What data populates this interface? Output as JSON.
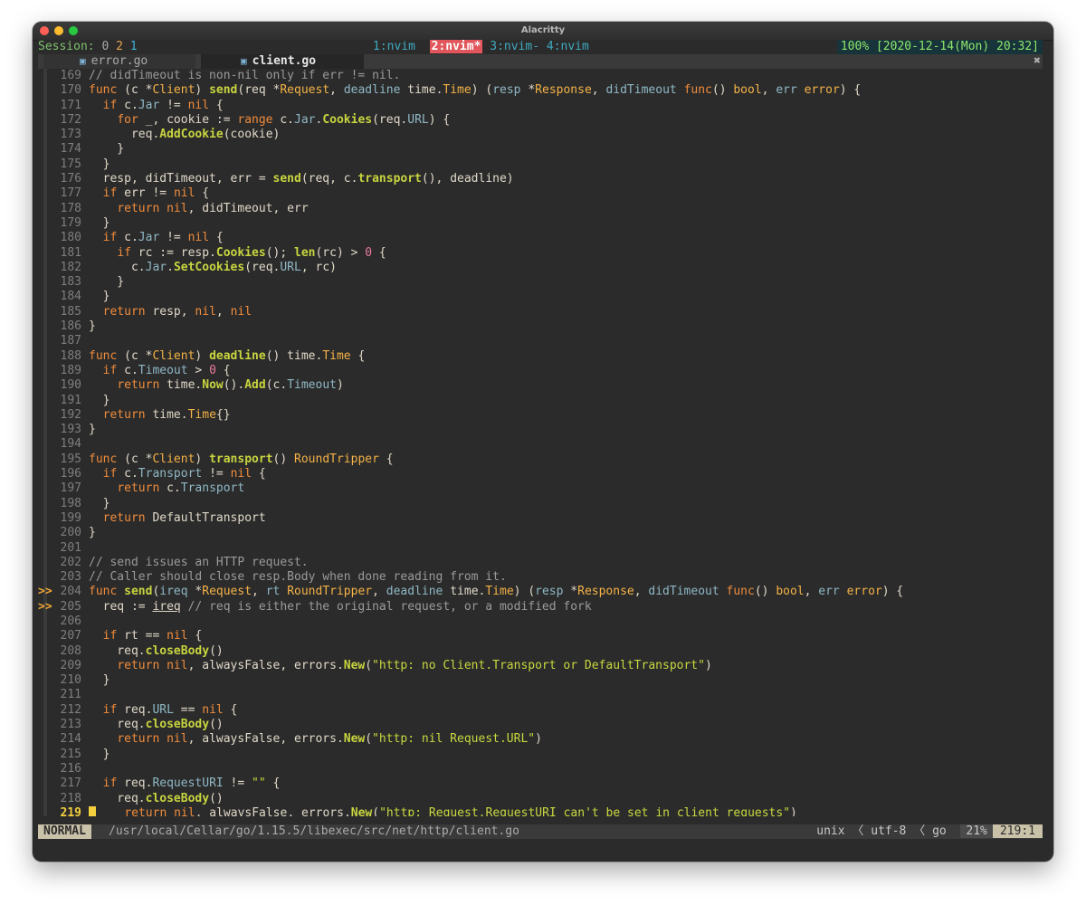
{
  "window": {
    "title": "Alacritty"
  },
  "tmux": {
    "session_label": "Session:",
    "session_nums": [
      "0",
      "2",
      "1"
    ],
    "windows": [
      "1:nvim",
      "2:nvim*",
      "3:nvim-",
      "4:nvim"
    ],
    "active_window": 1,
    "status": "100% [2020-12-14(Mon) 20:32]"
  },
  "tabs": [
    {
      "name": "error.go",
      "active": false
    },
    {
      "name": "client.go",
      "active": true
    }
  ],
  "tab_close_glyph": "✖",
  "statusline": {
    "mode": "NORMAL",
    "path": "/usr/local/Cellar/go/1.15.5/libexec/src/net/http/client.go",
    "format": "unix",
    "encoding": "utf-8",
    "filetype": "go",
    "percent": "21%",
    "position": "219:1"
  },
  "code_lines": [
    {
      "n": "",
      "sign": "",
      "tokens": [
        [
          "c",
          "// didTimeout is non-nil only if err != nil."
        ]
      ]
    },
    {
      "n": "169",
      "sign": "",
      "tokens": [
        [
          "c",
          "// didTimeout is non-nil only if err != nil."
        ]
      ]
    },
    {
      "n": "170",
      "sign": "",
      "tokens": [
        [
          "k",
          "func"
        ],
        [
          "op",
          " ("
        ],
        [
          "op",
          "c "
        ],
        [
          "op",
          "*"
        ],
        [
          "ty",
          "Client"
        ],
        [
          "op",
          ") "
        ],
        [
          "fn",
          "send"
        ],
        [
          "op",
          "(req "
        ],
        [
          "op",
          "*"
        ],
        [
          "ty",
          "Request"
        ],
        [
          "op",
          ", "
        ],
        [
          "f",
          "deadline"
        ],
        [
          "op",
          " time."
        ],
        [
          "ty",
          "Time"
        ],
        [
          "op",
          ") ("
        ],
        [
          "f",
          "resp"
        ],
        [
          "op",
          " *"
        ],
        [
          "ty",
          "Response"
        ],
        [
          "op",
          ", "
        ],
        [
          "f",
          "didTimeout"
        ],
        [
          "op",
          " "
        ],
        [
          "k",
          "func"
        ],
        [
          "op",
          "() "
        ],
        [
          "ty",
          "bool"
        ],
        [
          "op",
          ", "
        ],
        [
          "f",
          "err"
        ],
        [
          "op",
          " "
        ],
        [
          "ty",
          "error"
        ],
        [
          "op",
          ") {"
        ]
      ]
    },
    {
      "n": "171",
      "sign": "",
      "tokens": [
        [
          "op",
          "  "
        ],
        [
          "k",
          "if"
        ],
        [
          "op",
          " c."
        ],
        [
          "f",
          "Jar"
        ],
        [
          "op",
          " != "
        ],
        [
          "k",
          "nil"
        ],
        [
          "op",
          " {"
        ]
      ]
    },
    {
      "n": "172",
      "sign": "",
      "tokens": [
        [
          "op",
          "    "
        ],
        [
          "k",
          "for"
        ],
        [
          "op",
          " _, cookie := "
        ],
        [
          "k",
          "range"
        ],
        [
          "op",
          " c."
        ],
        [
          "f",
          "Jar"
        ],
        [
          "op",
          "."
        ],
        [
          "fn",
          "Cookies"
        ],
        [
          "op",
          "(req."
        ],
        [
          "f",
          "URL"
        ],
        [
          "op",
          ") {"
        ]
      ]
    },
    {
      "n": "173",
      "sign": "",
      "tokens": [
        [
          "op",
          "      req."
        ],
        [
          "fn",
          "AddCookie"
        ],
        [
          "op",
          "(cookie)"
        ]
      ]
    },
    {
      "n": "174",
      "sign": "",
      "tokens": [
        [
          "op",
          "    }"
        ]
      ]
    },
    {
      "n": "175",
      "sign": "",
      "tokens": [
        [
          "op",
          "  }"
        ]
      ]
    },
    {
      "n": "176",
      "sign": "",
      "tokens": [
        [
          "op",
          "  resp, didTimeout, err = "
        ],
        [
          "fn",
          "send"
        ],
        [
          "op",
          "(req, c."
        ],
        [
          "fn",
          "transport"
        ],
        [
          "op",
          "(), deadline)"
        ]
      ]
    },
    {
      "n": "177",
      "sign": "",
      "tokens": [
        [
          "op",
          "  "
        ],
        [
          "k",
          "if"
        ],
        [
          "op",
          " err != "
        ],
        [
          "k",
          "nil"
        ],
        [
          "op",
          " {"
        ]
      ]
    },
    {
      "n": "178",
      "sign": "",
      "tokens": [
        [
          "op",
          "    "
        ],
        [
          "k",
          "return"
        ],
        [
          "op",
          " "
        ],
        [
          "k",
          "nil"
        ],
        [
          "op",
          ", didTimeout, err"
        ]
      ]
    },
    {
      "n": "179",
      "sign": "",
      "tokens": [
        [
          "op",
          "  }"
        ]
      ]
    },
    {
      "n": "180",
      "sign": "",
      "tokens": [
        [
          "op",
          "  "
        ],
        [
          "k",
          "if"
        ],
        [
          "op",
          " c."
        ],
        [
          "f",
          "Jar"
        ],
        [
          "op",
          " != "
        ],
        [
          "k",
          "nil"
        ],
        [
          "op",
          " {"
        ]
      ]
    },
    {
      "n": "181",
      "sign": "",
      "tokens": [
        [
          "op",
          "    "
        ],
        [
          "k",
          "if"
        ],
        [
          "op",
          " rc := resp."
        ],
        [
          "fn",
          "Cookies"
        ],
        [
          "op",
          "(); "
        ],
        [
          "fn",
          "len"
        ],
        [
          "op",
          "(rc) > "
        ],
        [
          "nm",
          "0"
        ],
        [
          "op",
          " {"
        ]
      ]
    },
    {
      "n": "182",
      "sign": "",
      "tokens": [
        [
          "op",
          "      c."
        ],
        [
          "f",
          "Jar"
        ],
        [
          "op",
          "."
        ],
        [
          "fn",
          "SetCookies"
        ],
        [
          "op",
          "(req."
        ],
        [
          "f",
          "URL"
        ],
        [
          "op",
          ", rc)"
        ]
      ]
    },
    {
      "n": "183",
      "sign": "",
      "tokens": [
        [
          "op",
          "    }"
        ]
      ]
    },
    {
      "n": "184",
      "sign": "",
      "tokens": [
        [
          "op",
          "  }"
        ]
      ]
    },
    {
      "n": "185",
      "sign": "",
      "tokens": [
        [
          "op",
          "  "
        ],
        [
          "k",
          "return"
        ],
        [
          "op",
          " resp, "
        ],
        [
          "k",
          "nil"
        ],
        [
          "op",
          ", "
        ],
        [
          "k",
          "nil"
        ]
      ]
    },
    {
      "n": "186",
      "sign": "",
      "tokens": [
        [
          "op",
          "}"
        ]
      ]
    },
    {
      "n": "187",
      "sign": "",
      "tokens": []
    },
    {
      "n": "188",
      "sign": "",
      "tokens": [
        [
          "k",
          "func"
        ],
        [
          "op",
          " (c "
        ],
        [
          "op",
          "*"
        ],
        [
          "ty",
          "Client"
        ],
        [
          "op",
          ") "
        ],
        [
          "fn",
          "deadline"
        ],
        [
          "op",
          "() time."
        ],
        [
          "ty",
          "Time"
        ],
        [
          "op",
          " {"
        ]
      ]
    },
    {
      "n": "189",
      "sign": "",
      "tokens": [
        [
          "op",
          "  "
        ],
        [
          "k",
          "if"
        ],
        [
          "op",
          " c."
        ],
        [
          "f",
          "Timeout"
        ],
        [
          "op",
          " > "
        ],
        [
          "nm",
          "0"
        ],
        [
          "op",
          " {"
        ]
      ]
    },
    {
      "n": "190",
      "sign": "",
      "tokens": [
        [
          "op",
          "    "
        ],
        [
          "k",
          "return"
        ],
        [
          "op",
          " time."
        ],
        [
          "fn",
          "Now"
        ],
        [
          "op",
          "()."
        ],
        [
          "fn",
          "Add"
        ],
        [
          "op",
          "(c."
        ],
        [
          "f",
          "Timeout"
        ],
        [
          "op",
          ")"
        ]
      ]
    },
    {
      "n": "191",
      "sign": "",
      "tokens": [
        [
          "op",
          "  }"
        ]
      ]
    },
    {
      "n": "192",
      "sign": "",
      "tokens": [
        [
          "op",
          "  "
        ],
        [
          "k",
          "return"
        ],
        [
          "op",
          " time."
        ],
        [
          "ty",
          "Time"
        ],
        [
          "op",
          "{}"
        ]
      ]
    },
    {
      "n": "193",
      "sign": "",
      "tokens": [
        [
          "op",
          "}"
        ]
      ]
    },
    {
      "n": "194",
      "sign": "",
      "tokens": []
    },
    {
      "n": "195",
      "sign": "",
      "tokens": [
        [
          "k",
          "func"
        ],
        [
          "op",
          " (c "
        ],
        [
          "op",
          "*"
        ],
        [
          "ty",
          "Client"
        ],
        [
          "op",
          ") "
        ],
        [
          "fn",
          "transport"
        ],
        [
          "op",
          "() "
        ],
        [
          "ty",
          "RoundTripper"
        ],
        [
          "op",
          " {"
        ]
      ]
    },
    {
      "n": "196",
      "sign": "",
      "tokens": [
        [
          "op",
          "  "
        ],
        [
          "k",
          "if"
        ],
        [
          "op",
          " c."
        ],
        [
          "f",
          "Transport"
        ],
        [
          "op",
          " != "
        ],
        [
          "k",
          "nil"
        ],
        [
          "op",
          " {"
        ]
      ]
    },
    {
      "n": "197",
      "sign": "",
      "tokens": [
        [
          "op",
          "    "
        ],
        [
          "k",
          "return"
        ],
        [
          "op",
          " c."
        ],
        [
          "f",
          "Transport"
        ]
      ]
    },
    {
      "n": "198",
      "sign": "",
      "tokens": [
        [
          "op",
          "  }"
        ]
      ]
    },
    {
      "n": "199",
      "sign": "",
      "tokens": [
        [
          "op",
          "  "
        ],
        [
          "k",
          "return"
        ],
        [
          "op",
          " DefaultTransport"
        ]
      ]
    },
    {
      "n": "200",
      "sign": "",
      "tokens": [
        [
          "op",
          "}"
        ]
      ]
    },
    {
      "n": "201",
      "sign": "",
      "tokens": []
    },
    {
      "n": "202",
      "sign": "",
      "tokens": [
        [
          "c",
          "// send issues an HTTP request."
        ]
      ]
    },
    {
      "n": "203",
      "sign": "",
      "tokens": [
        [
          "c",
          "// Caller should close resp.Body when done reading from it."
        ]
      ]
    },
    {
      "n": "204",
      "sign": ">>",
      "tokens": [
        [
          "k",
          "func"
        ],
        [
          "op",
          " "
        ],
        [
          "fn",
          "send"
        ],
        [
          "op",
          "("
        ],
        [
          "f",
          "ireq"
        ],
        [
          "op",
          " *"
        ],
        [
          "ty",
          "Request"
        ],
        [
          "op",
          ", "
        ],
        [
          "f",
          "rt"
        ],
        [
          "op",
          " "
        ],
        [
          "ty",
          "RoundTripper"
        ],
        [
          "op",
          ", "
        ],
        [
          "f",
          "deadline"
        ],
        [
          "op",
          " time."
        ],
        [
          "ty",
          "Time"
        ],
        [
          "op",
          ") ("
        ],
        [
          "f",
          "resp"
        ],
        [
          "op",
          " *"
        ],
        [
          "ty",
          "Response"
        ],
        [
          "op",
          ", "
        ],
        [
          "f",
          "didTimeout"
        ],
        [
          "op",
          " "
        ],
        [
          "k",
          "func"
        ],
        [
          "op",
          "() "
        ],
        [
          "ty",
          "bool"
        ],
        [
          "op",
          ", "
        ],
        [
          "f",
          "err"
        ],
        [
          "op",
          " "
        ],
        [
          "ty",
          "error"
        ],
        [
          "op",
          ") {"
        ]
      ]
    },
    {
      "n": "205",
      "sign": ">>",
      "tokens": [
        [
          "op",
          "  req := "
        ],
        [
          "u",
          "ireq"
        ],
        [
          "c",
          " // req is either the original request, or a modified fork"
        ]
      ]
    },
    {
      "n": "206",
      "sign": "",
      "tokens": []
    },
    {
      "n": "207",
      "sign": "",
      "tokens": [
        [
          "op",
          "  "
        ],
        [
          "k",
          "if"
        ],
        [
          "op",
          " rt == "
        ],
        [
          "k",
          "nil"
        ],
        [
          "op",
          " {"
        ]
      ]
    },
    {
      "n": "208",
      "sign": "",
      "tokens": [
        [
          "op",
          "    req."
        ],
        [
          "fn",
          "closeBody"
        ],
        [
          "op",
          "()"
        ]
      ]
    },
    {
      "n": "209",
      "sign": "",
      "tokens": [
        [
          "op",
          "    "
        ],
        [
          "k",
          "return"
        ],
        [
          "op",
          " "
        ],
        [
          "k",
          "nil"
        ],
        [
          "op",
          ", alwaysFalse, errors."
        ],
        [
          "fn",
          "New"
        ],
        [
          "op",
          "("
        ],
        [
          "s",
          "\"http: no Client.Transport or DefaultTransport\""
        ],
        [
          "op",
          ")"
        ]
      ]
    },
    {
      "n": "210",
      "sign": "",
      "tokens": [
        [
          "op",
          "  }"
        ]
      ]
    },
    {
      "n": "211",
      "sign": "",
      "tokens": []
    },
    {
      "n": "212",
      "sign": "",
      "tokens": [
        [
          "op",
          "  "
        ],
        [
          "k",
          "if"
        ],
        [
          "op",
          " req."
        ],
        [
          "f",
          "URL"
        ],
        [
          "op",
          " == "
        ],
        [
          "k",
          "nil"
        ],
        [
          "op",
          " {"
        ]
      ]
    },
    {
      "n": "213",
      "sign": "",
      "tokens": [
        [
          "op",
          "    req."
        ],
        [
          "fn",
          "closeBody"
        ],
        [
          "op",
          "()"
        ]
      ]
    },
    {
      "n": "214",
      "sign": "",
      "tokens": [
        [
          "op",
          "    "
        ],
        [
          "k",
          "return"
        ],
        [
          "op",
          " "
        ],
        [
          "k",
          "nil"
        ],
        [
          "op",
          ", alwaysFalse, errors."
        ],
        [
          "fn",
          "New"
        ],
        [
          "op",
          "("
        ],
        [
          "s",
          "\"http: nil Request.URL\""
        ],
        [
          "op",
          ")"
        ]
      ]
    },
    {
      "n": "215",
      "sign": "",
      "tokens": [
        [
          "op",
          "  }"
        ]
      ]
    },
    {
      "n": "216",
      "sign": "",
      "tokens": []
    },
    {
      "n": "217",
      "sign": "",
      "tokens": [
        [
          "op",
          "  "
        ],
        [
          "k",
          "if"
        ],
        [
          "op",
          " req."
        ],
        [
          "f",
          "RequestURI"
        ],
        [
          "op",
          " != "
        ],
        [
          "s",
          "\"\""
        ],
        [
          "op",
          " {"
        ]
      ]
    },
    {
      "n": "218",
      "sign": "",
      "tokens": [
        [
          "op",
          "    req."
        ],
        [
          "fn",
          "closeBody"
        ],
        [
          "op",
          "()"
        ]
      ]
    },
    {
      "n": "219",
      "sign": "",
      "cur": true,
      "tokens": [
        [
          "op",
          "    "
        ],
        [
          "k",
          "return"
        ],
        [
          "op",
          " "
        ],
        [
          "k",
          "nil"
        ],
        [
          "op",
          ", alwaysFalse, errors."
        ],
        [
          "fn",
          "New"
        ],
        [
          "op",
          "("
        ],
        [
          "s",
          "\"http: Request.RequestURI can't be set in client requests\""
        ],
        [
          "op",
          ")"
        ]
      ]
    }
  ]
}
